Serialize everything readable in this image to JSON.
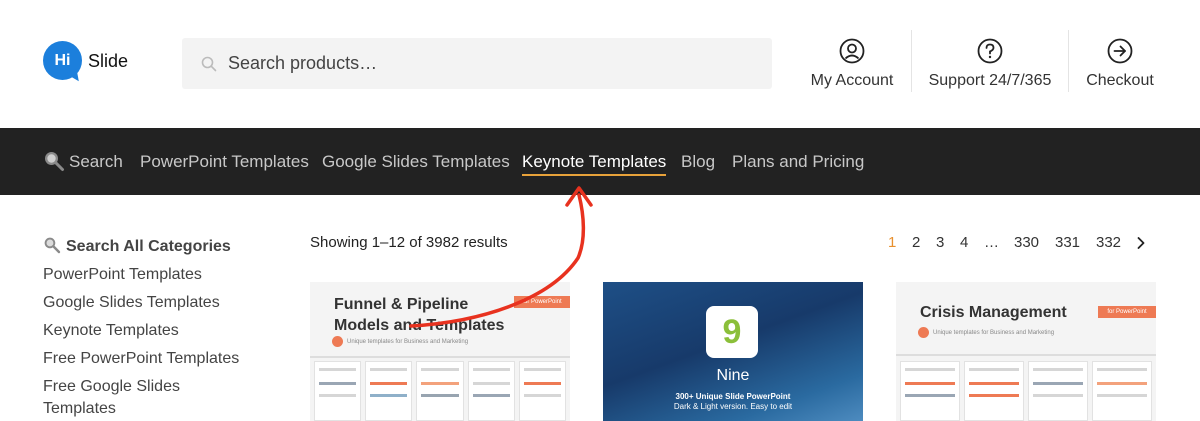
{
  "brand": {
    "logo_mark": "Hi",
    "logo_text": "Slide",
    "primary_color": "#1c7fdc",
    "accent_color": "#e8902e"
  },
  "search": {
    "placeholder": "Search products…"
  },
  "header_actions": [
    {
      "label": "My Account",
      "icon": "user-circle-icon"
    },
    {
      "label": "Support 24/7/365",
      "icon": "help-circle-icon"
    },
    {
      "label": "Checkout",
      "icon": "arrow-right-circle-icon"
    }
  ],
  "nav": {
    "search_label": "Search",
    "items": [
      {
        "label": "PowerPoint Templates"
      },
      {
        "label": "Google Slides Templates"
      },
      {
        "label": "Keynote Templates",
        "active": true
      },
      {
        "label": "Blog"
      },
      {
        "label": "Plans and Pricing"
      }
    ]
  },
  "sidebar": {
    "title": "Search All Categories",
    "items": [
      {
        "label": "PowerPoint Templates"
      },
      {
        "label": "Google Slides Templates"
      },
      {
        "label": "Keynote Templates"
      },
      {
        "label": "Free PowerPoint Templates"
      },
      {
        "label": "Free Google Slides Templates"
      }
    ]
  },
  "results": {
    "count_text": "Showing 1–12 of 3982 results",
    "pagination": [
      "1",
      "2",
      "3",
      "4",
      "…",
      "330",
      "331",
      "332"
    ],
    "current_page": "1",
    "next_icon": "chevron-right-icon"
  },
  "products": [
    {
      "title": "Funnel & Pipeline\nModels and Templates",
      "tag": "for PowerPoint",
      "subtitle": "Unique templates for Business and Marketing"
    },
    {
      "badge": "9",
      "name": "Nine",
      "desc_line1": "300+ Unique Slide PowerPoint",
      "desc_line2": "Dark & Light version. Easy to edit"
    },
    {
      "title": "Crisis Management",
      "tag": "for PowerPoint",
      "subtitle": "Unique templates for Business and Marketing"
    }
  ]
}
